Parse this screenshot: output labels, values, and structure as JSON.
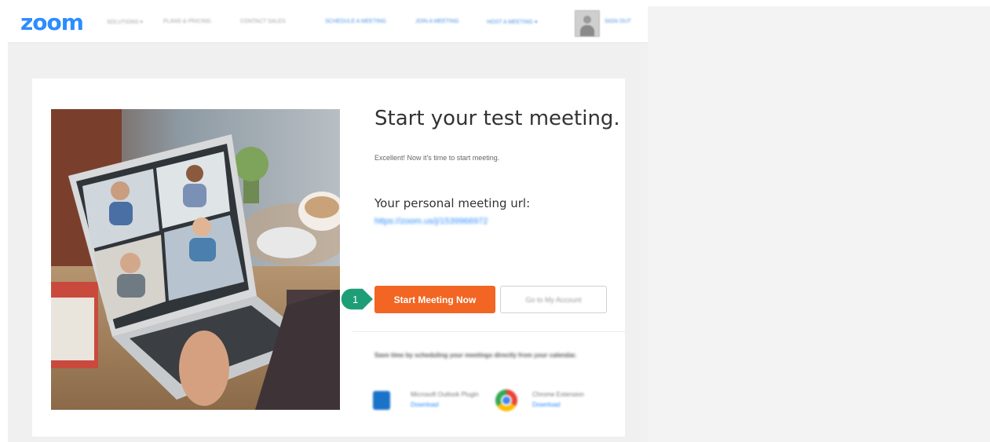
{
  "header": {
    "logo": "zoom",
    "nav_left": [
      "SOLUTIONS ▾",
      "PLANS & PRICING",
      "CONTACT SALES"
    ],
    "nav_right": [
      "SCHEDULE A MEETING",
      "JOIN A MEETING",
      "HOST A MEETING ▾"
    ],
    "sign_out": "SIGN OUT"
  },
  "main": {
    "title": "Start your test meeting.",
    "subtitle": "Excellent! Now it's time to start meeting.",
    "url_label": "Your personal meeting url:",
    "url_value": "https://zoom.us/j/1539966972",
    "start_button": "Start Meeting Now",
    "account_button": "Go to My Account",
    "callout_number": "1",
    "calendar_text": "Save time by scheduling your meetings directly from your calendar.",
    "plugins": [
      {
        "name": "Microsoft Outlook Plugin",
        "link": "Download",
        "icon": "outlook-icon"
      },
      {
        "name": "Chrome Extension",
        "link": "Download",
        "icon": "chrome-icon"
      }
    ]
  },
  "colors": {
    "brand": "#2D8CFF",
    "start_button": "#F26522",
    "callout": "#1E9E76"
  }
}
